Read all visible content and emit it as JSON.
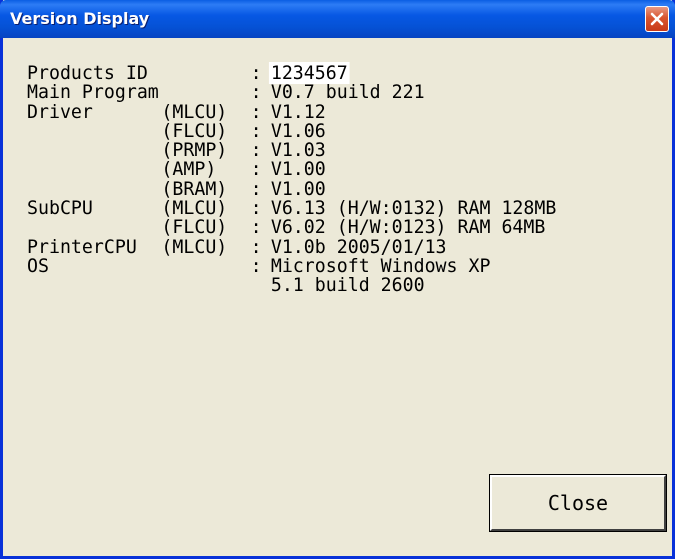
{
  "window": {
    "title": "Version Display",
    "colors": {
      "titlebar": "#0758e4",
      "close": "#d9552f",
      "background": "#ece9d8"
    }
  },
  "info": {
    "rows": [
      {
        "label": "Products ID",
        "sub": "",
        "value": "1234567",
        "highlight": true
      },
      {
        "label": "Main Program",
        "sub": "",
        "value": "V0.7 build 221"
      },
      {
        "label": "Driver",
        "sub": "(MLCU)",
        "value": "V1.12"
      },
      {
        "label": "",
        "sub": "(FLCU)",
        "value": "V1.06"
      },
      {
        "label": "",
        "sub": "(PRMP)",
        "value": "V1.03"
      },
      {
        "label": "",
        "sub": "(AMP)",
        "value": "V1.00"
      },
      {
        "label": "",
        "sub": "(BRAM)",
        "value": "V1.00"
      },
      {
        "label": "SubCPU",
        "sub": "(MLCU)",
        "value": "V6.13 (H/W:0132) RAM 128MB"
      },
      {
        "label": "",
        "sub": "(FLCU)",
        "value": "V6.02 (H/W:0123) RAM 64MB"
      },
      {
        "label": "PrinterCPU",
        "sub": "(MLCU)",
        "value": "V1.0b 2005/01/13"
      },
      {
        "label": "OS",
        "sub": "",
        "value": "Microsoft Windows XP"
      },
      {
        "label": "",
        "sub": "",
        "value": "5.1 build 2600",
        "noColon": true
      }
    ]
  },
  "buttons": {
    "close_label": "Close"
  },
  "icons": {
    "titlebar_close": "close-icon"
  }
}
